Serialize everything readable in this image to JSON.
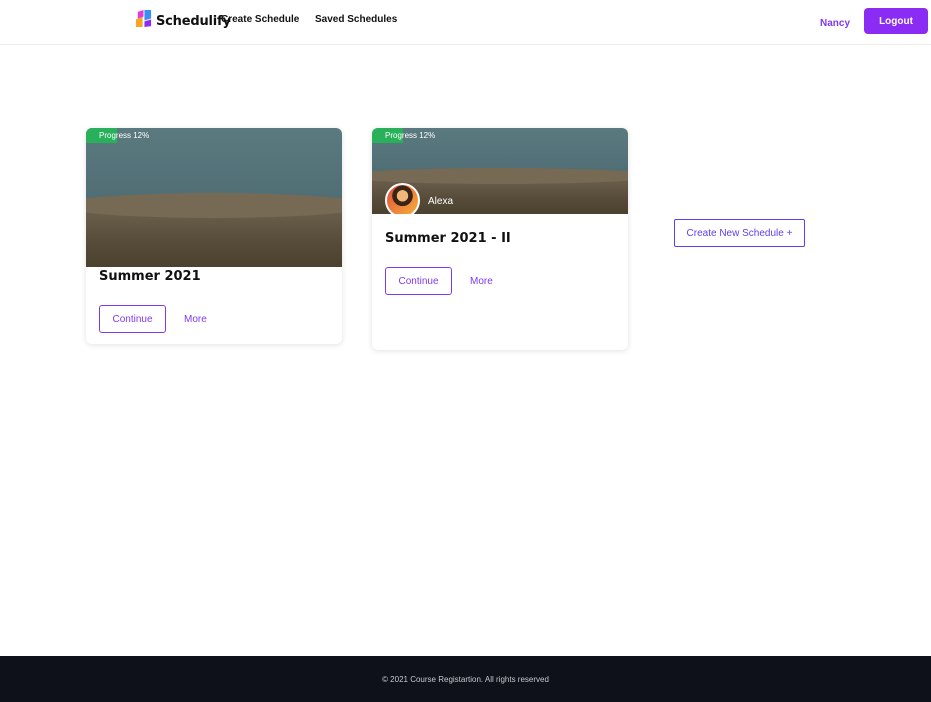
{
  "header": {
    "brand": "Schedulify",
    "logo_icon": "schedulify-logo-icon",
    "nav": {
      "create_schedule": "Create Schedule",
      "saved_schedules": "Saved Schedules"
    },
    "user": "Nancy",
    "logout_label": "Logout"
  },
  "colors": {
    "accent": "#8b2cf5",
    "link": "#7e3af2",
    "progress": "#28b15a",
    "footer_bg": "#0e101a"
  },
  "schedules": [
    {
      "progress_label": "Progress 12%",
      "progress": 0.12,
      "title": "Summer 2021",
      "continue_label": "Continue",
      "more_label": "More"
    },
    {
      "progress_label": "Progress 12%",
      "progress": 0.12,
      "owner": "Alexa",
      "title": "Summer 2021 - II",
      "continue_label": "Continue",
      "more_label": "More"
    }
  ],
  "create_new_label": "Create New Schedule +",
  "footer": {
    "copyright": "© 2021 Course Registartion. All rights reserved"
  }
}
